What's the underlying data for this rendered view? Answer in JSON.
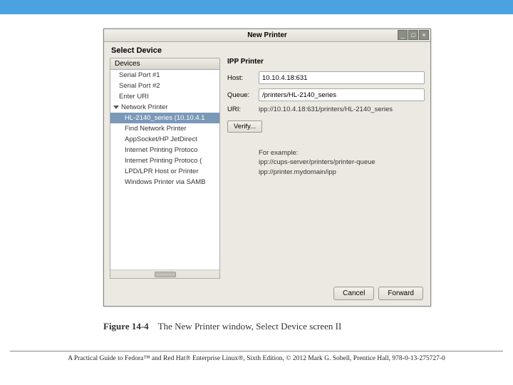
{
  "topbar": {},
  "window": {
    "title": "New Printer",
    "heading": "Select Device",
    "devices_label": "Devices",
    "items": {
      "serial1": "Serial Port #1",
      "serial2": "Serial Port #2",
      "enter_uri": "Enter URI",
      "network": "Network Printer",
      "selected": "HL-2140_series (10.10.4.1",
      "find": "Find Network Printer",
      "appsocket": "AppSocket/HP JetDirect",
      "ipp1": "Internet Printing Protoco",
      "ipp2": "Internet Printing Protoco (",
      "lpd": "LPD/LPR Host or Printer",
      "samba": "Windows Printer via SAMB"
    },
    "right": {
      "title": "IPP Printer",
      "host_label": "Host:",
      "host_value": "10.10.4.18:631",
      "queue_label": "Queue:",
      "queue_value": "/printers/HL-2140_series",
      "uri_label": "URI:",
      "uri_value": "ipp://10.10.4.18:631/printers/HL-2140_series",
      "verify": "Verify...",
      "example_heading": "For example:",
      "example1": "ipp://cups-server/printers/printer-queue",
      "example2": "ipp://printer.mydomain/ipp"
    },
    "buttons": {
      "cancel": "Cancel",
      "forward": "Forward"
    }
  },
  "caption": {
    "fig": "Figure 14-4",
    "text": "The New Printer window, Select Device screen II"
  },
  "citation": "A Practical Guide to Fedora™ and Red Hat® Enterprise Linux®, Sixth Edition, © 2012 Mark G. Sobell, Prentice Hall, 978-0-13-275727-0"
}
